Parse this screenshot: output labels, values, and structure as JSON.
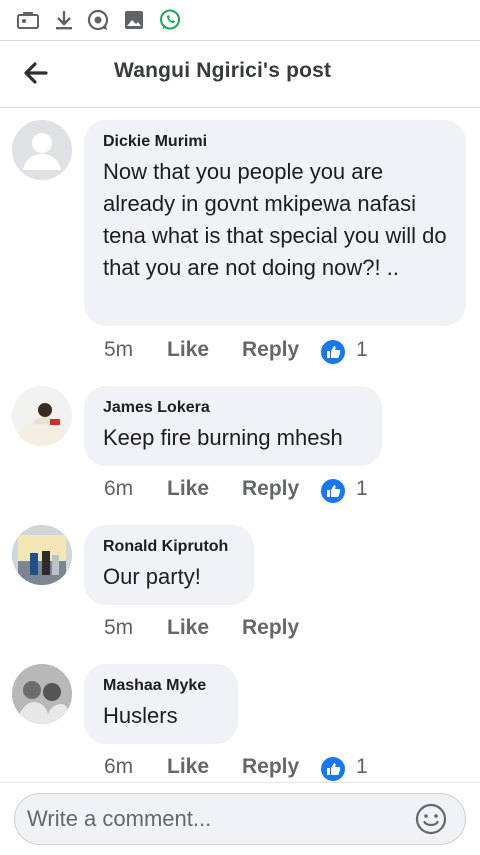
{
  "status_bar": {
    "icons": [
      "briefcase-notification-icon",
      "download-icon",
      "photo-sync-icon",
      "gallery-icon",
      "whatsapp-icon"
    ]
  },
  "header": {
    "title": "Wangui Ngirici's post",
    "back_icon": "arrow-left-icon"
  },
  "comments": [
    {
      "author": "Dickie Murimi",
      "text": "Now that you people you are already in govnt mkipewa nafasi tena what is that special you will do that you are not doing now?! ..",
      "time": "5m",
      "like": "Like",
      "reply": "Reply",
      "reactions": "1",
      "avatar": "default-profile-avatar"
    },
    {
      "author": "James Lokera",
      "text": "Keep fire burning mhesh",
      "time": "6m",
      "like": "Like",
      "reply": "Reply",
      "reactions": "1",
      "avatar": "profile-photo"
    },
    {
      "author": "Ronald Kiprutoh",
      "text": "Our party!",
      "time": "5m",
      "like": "Like",
      "reply": "Reply",
      "reactions": "",
      "avatar": "profile-photo"
    },
    {
      "author": "Mashaa Myke",
      "text": "Huslers",
      "time": "6m",
      "like": "Like",
      "reply": "Reply",
      "reactions": "1",
      "avatar": "profile-photo"
    }
  ],
  "composer": {
    "placeholder": "Write a comment...",
    "emoji_icon": "smiley-face-icon"
  },
  "colors": {
    "bubble": "#f0f2f5",
    "like_reaction": "#1877f2",
    "whatsapp": "#25d366",
    "status_icons": "#5f6368"
  }
}
